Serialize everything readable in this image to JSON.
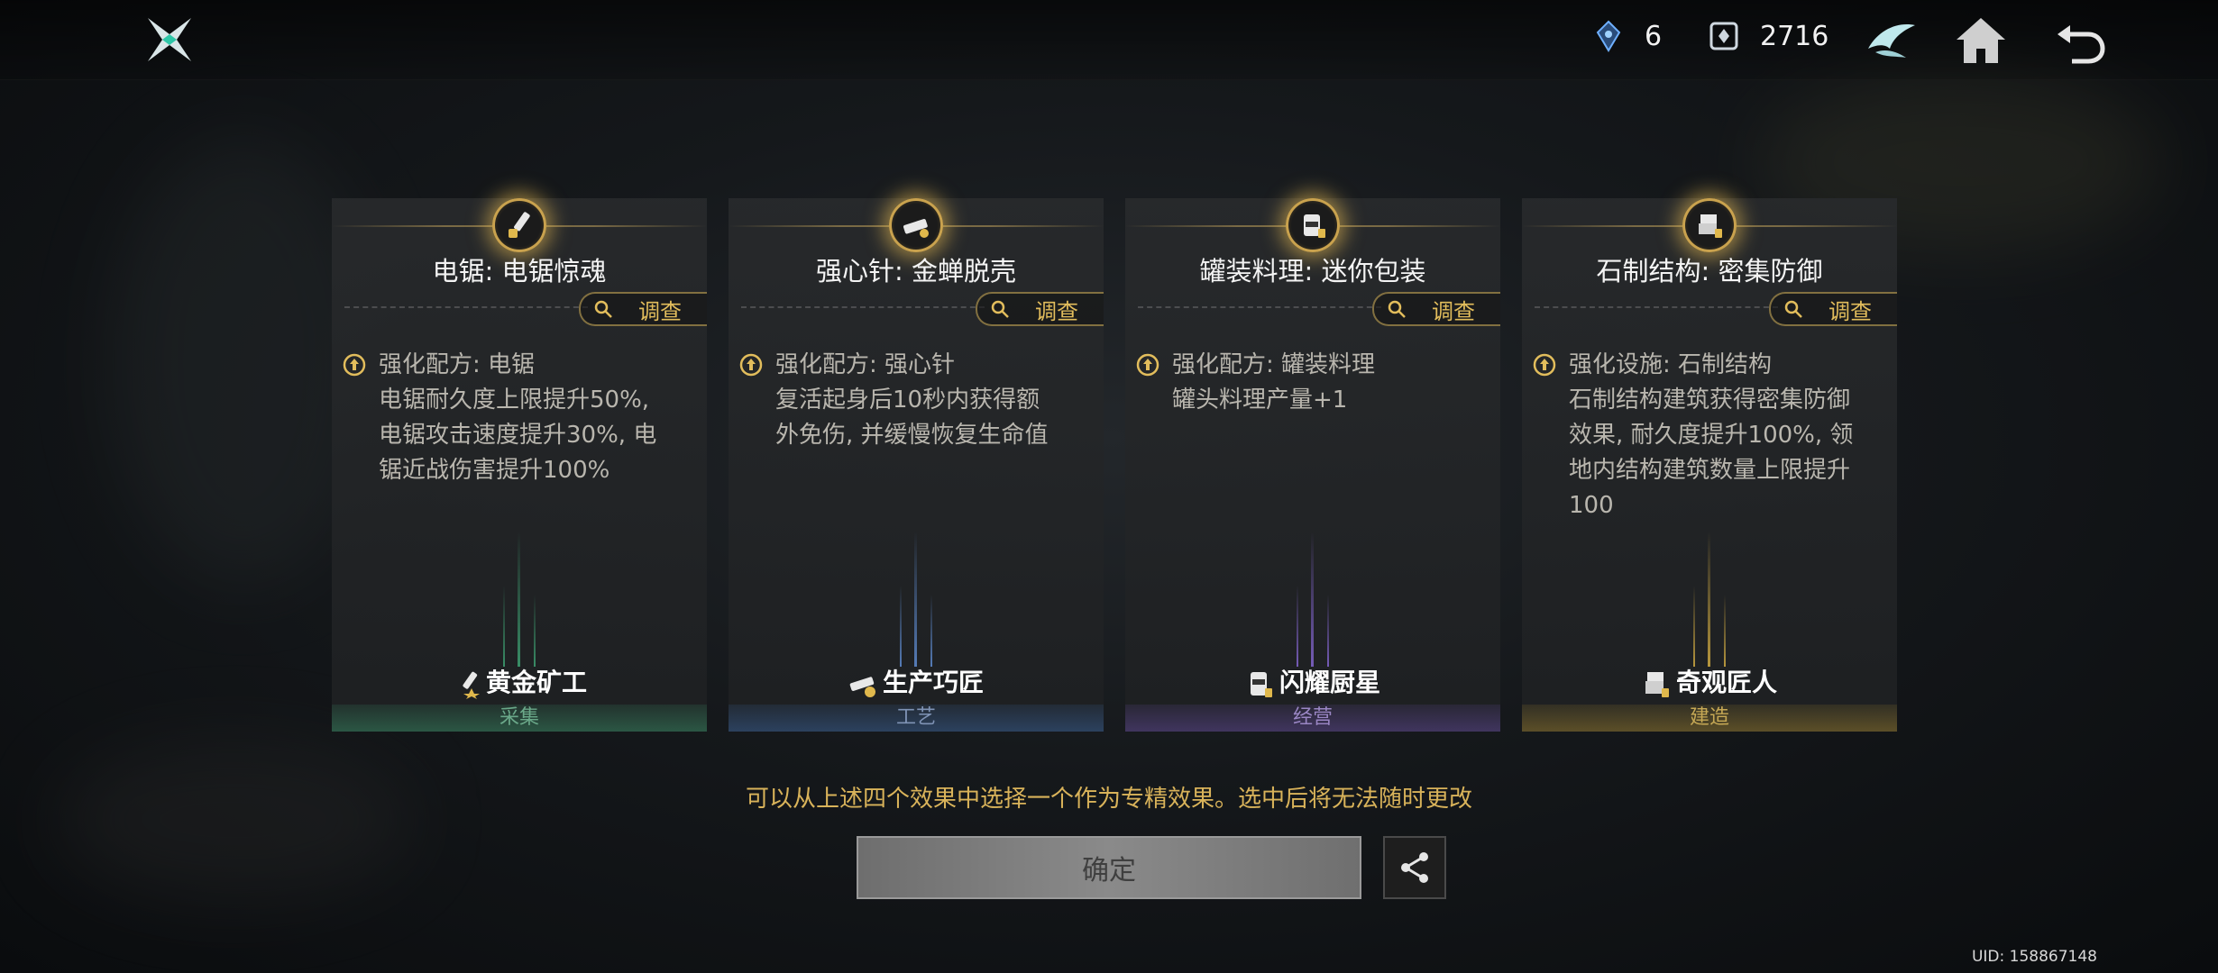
{
  "topbar": {
    "resources": [
      {
        "icon": "crystal-icon",
        "value": "6"
      },
      {
        "icon": "token-icon",
        "value": "2716"
      }
    ],
    "buttons": [
      "wing-emblem-icon",
      "home-icon",
      "back-icon"
    ]
  },
  "cards": [
    {
      "title": "电锯: 电锯惊魂",
      "investigate": "调查",
      "effect_head": "强化配方: 电锯",
      "effect_desc": "电锯耐久度上限提升50%,\n电锯攻击速度提升30%, 电\n锯近战伤害提升100%",
      "role": "黄金矿工",
      "category": "采集",
      "accent": "#3c9a6e",
      "cat_color": "#6aa889",
      "icon": "chainsaw-icon"
    },
    {
      "title": "强心针: 金蝉脱壳",
      "investigate": "调查",
      "effect_head": "强化配方: 强心针",
      "effect_desc": "复活起身后10秒内获得额\n外免伤, 并缓慢恢复生命值",
      "role": "生产巧匠",
      "category": "工艺",
      "accent": "#3d6aa8",
      "cat_color": "#7f93b5",
      "icon": "stimulant-icon"
    },
    {
      "title": "罐装料理: 迷你包装",
      "investigate": "调查",
      "effect_head": "强化配方: 罐装料理",
      "effect_desc": "罐头料理产量+1",
      "role": "闪耀厨星",
      "category": "经营",
      "accent": "#6a4fa8",
      "cat_color": "#9a86c4",
      "icon": "canned-food-icon"
    },
    {
      "title": "石制结构: 密集防御",
      "investigate": "调查",
      "effect_head": "强化设施: 石制结构",
      "effect_desc": "石制结构建筑获得密集防御\n效果, 耐久度提升100%, 领\n地内结构建筑数量上限提升\n100",
      "role": "奇观匠人",
      "category": "建造",
      "accent": "#a8892f",
      "cat_color": "#c7a955",
      "icon": "stone-structure-icon"
    }
  ],
  "hint": "可以从上述四个效果中选择一个作为专精效果。选中后将无法随时更改",
  "confirm_label": "确定",
  "uid": "UID: 158867148"
}
